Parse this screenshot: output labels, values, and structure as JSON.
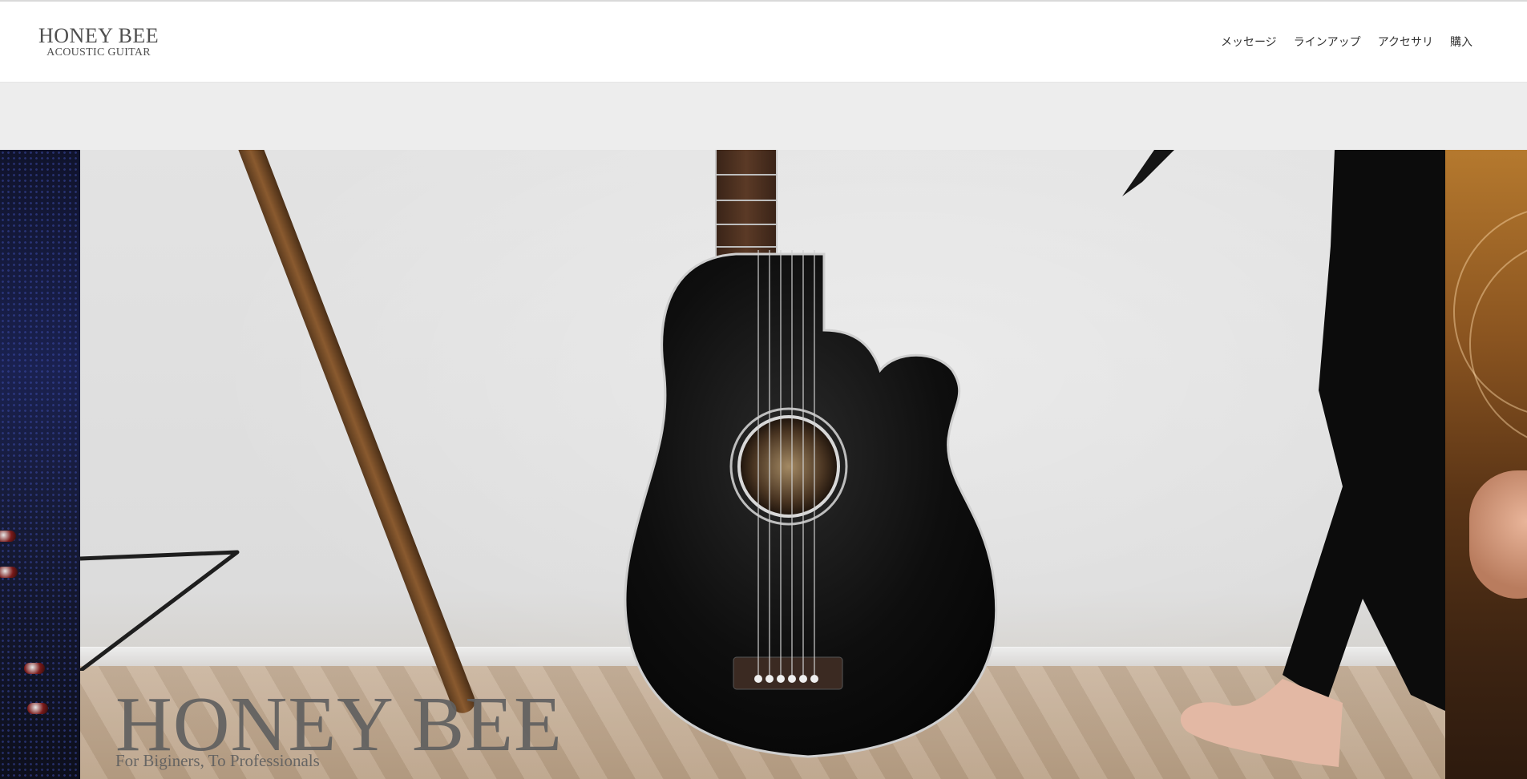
{
  "header": {
    "brand_name": "HONEY BEE",
    "brand_sub": "ACOUSTIC GUITAR",
    "nav": [
      {
        "label": "メッセージ"
      },
      {
        "label": "ラインアップ"
      },
      {
        "label": "アクセサリ"
      },
      {
        "label": "購入"
      }
    ]
  },
  "hero": {
    "title": "HONEY BEE",
    "subtitle": "For Biginers, To Professionals"
  },
  "colors": {
    "header_bg": "#ffffff",
    "page_bg": "#ededed",
    "text_gray": "#5f5f5f"
  }
}
